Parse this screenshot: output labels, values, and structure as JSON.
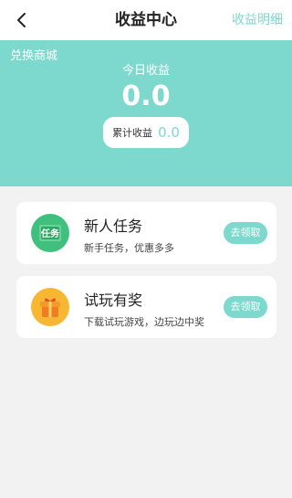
{
  "nav": {
    "title": "收益中心",
    "right_link": "收益明细",
    "back_icon": "chevron-left-icon"
  },
  "banner": {
    "shop_link": "兑换商城",
    "today_label": "今日收益",
    "today_value": "0.0",
    "total_label": "累计收益",
    "total_value": "0.0",
    "background": "#7dd9cd"
  },
  "tasks": [
    {
      "title": "新人任务",
      "desc": "新手任务，优惠多多",
      "button": "去领取",
      "icon_text": "任务",
      "icon": "task-icon",
      "icon_color": "#3fc07c"
    },
    {
      "title": "试玩有奖",
      "desc": "下载试玩游戏，边玩边中奖",
      "button": "去领取",
      "icon": "gift-icon",
      "icon_color": "#f5a623"
    }
  ],
  "colors": {
    "accent": "#7dd9cd",
    "page_bg": "#f2f2f2"
  }
}
